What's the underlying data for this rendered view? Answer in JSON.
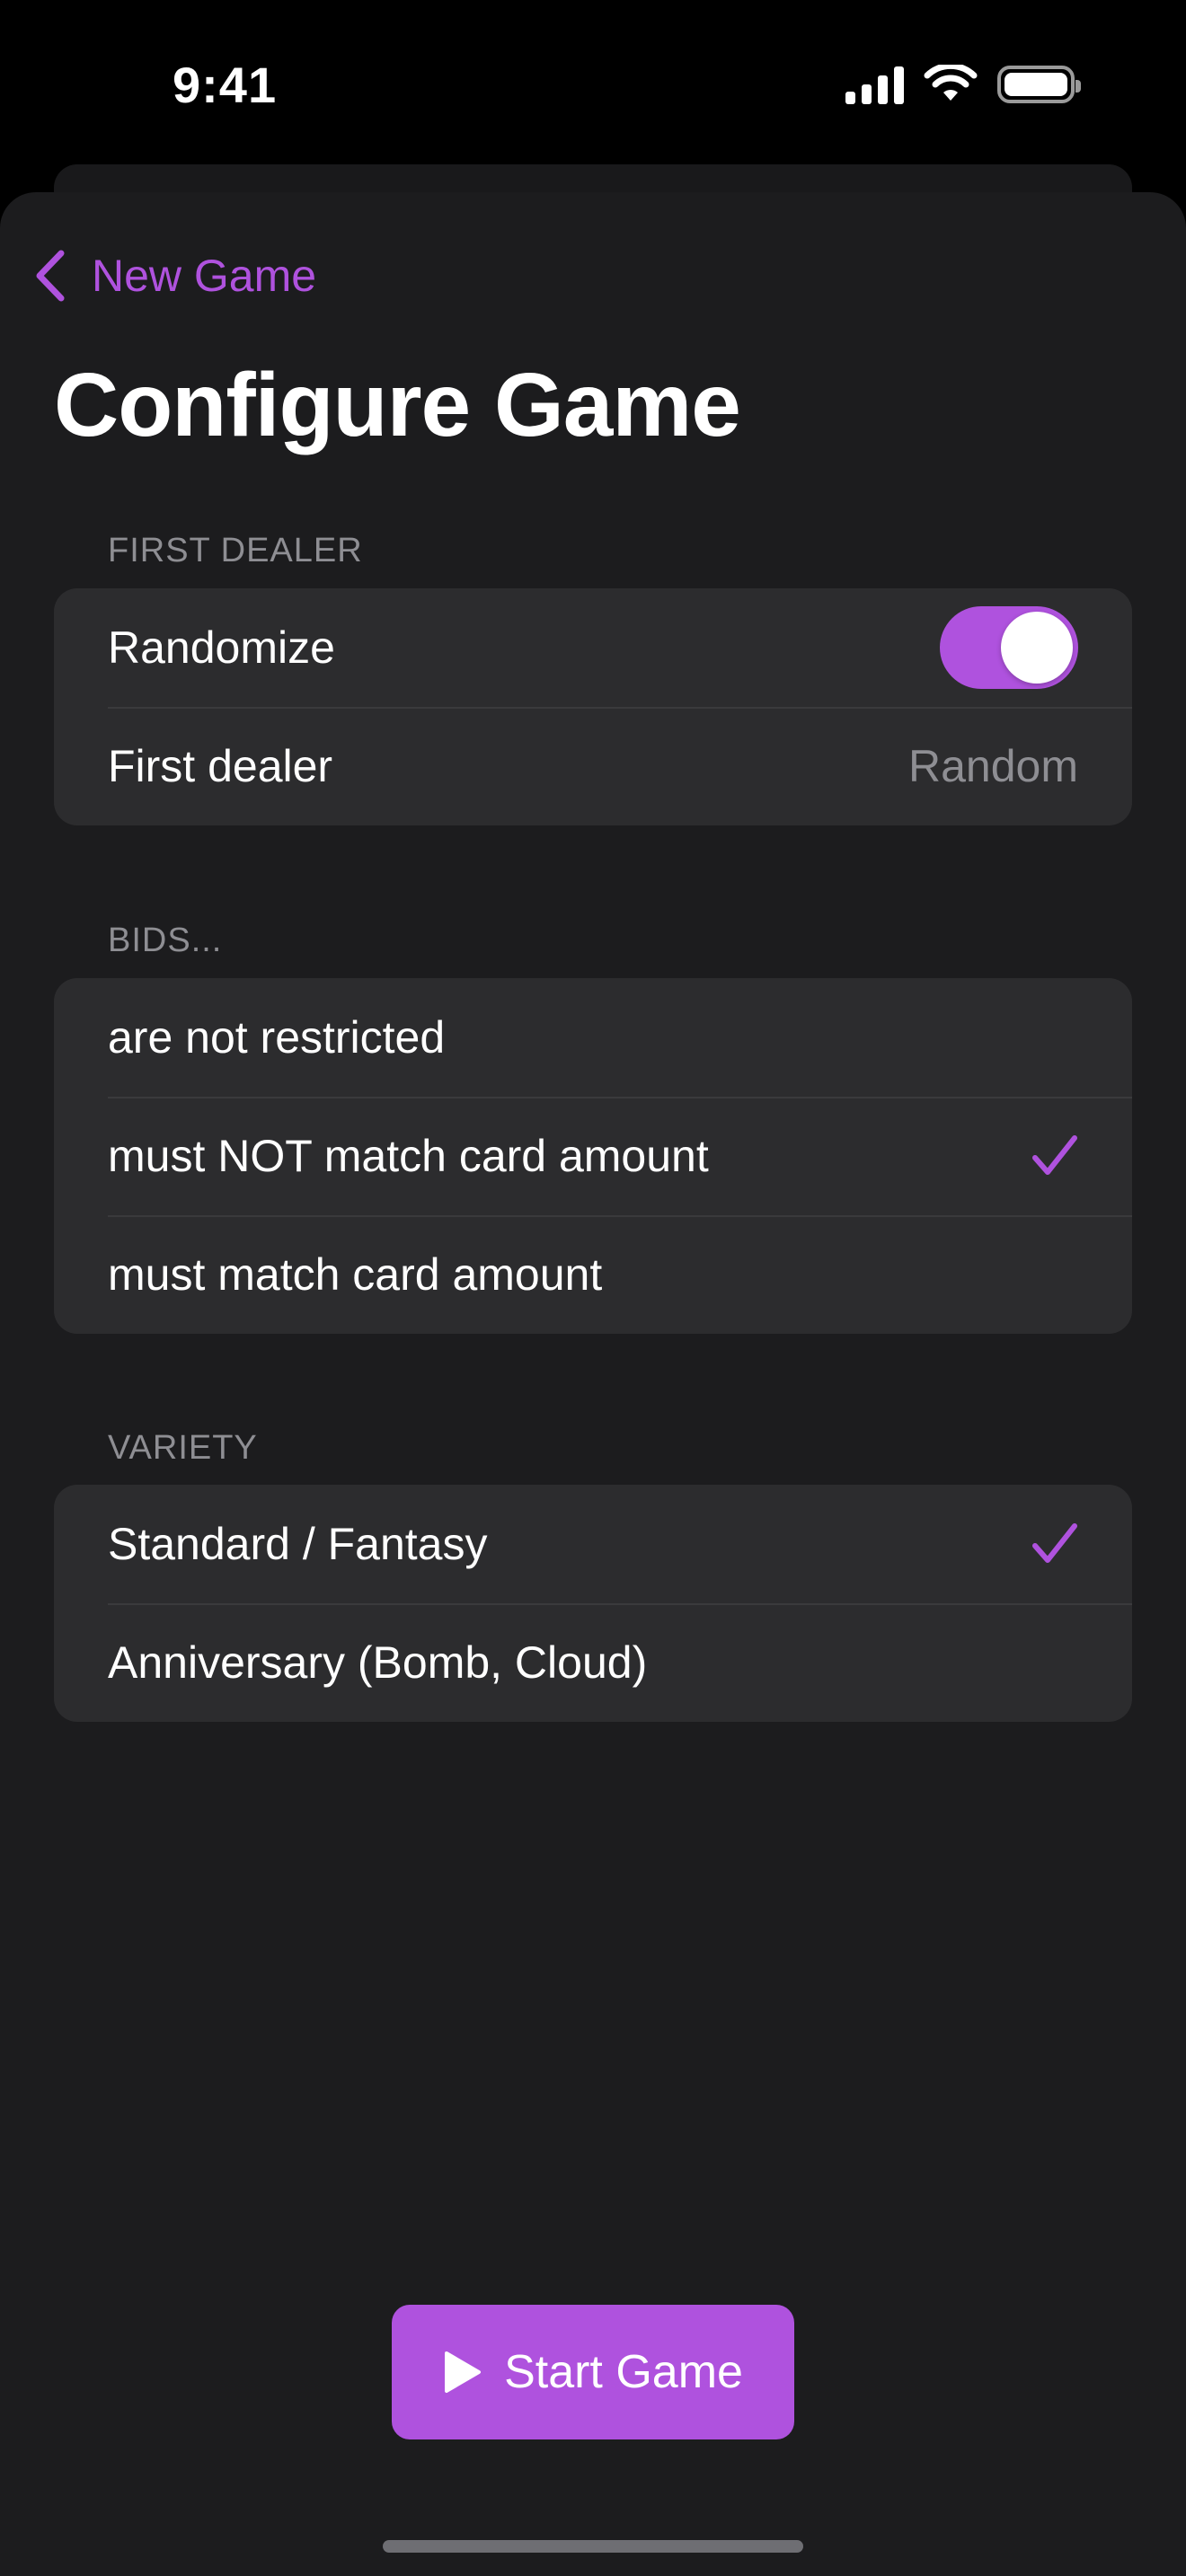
{
  "status_bar": {
    "time": "9:41"
  },
  "nav": {
    "back_label": "New Game"
  },
  "title": "Configure Game",
  "colors": {
    "accent": "#af52de",
    "background": "#1c1c1e",
    "cell": "#2c2c2e",
    "secondary_text": "#8e8e93"
  },
  "sections": {
    "first_dealer": {
      "header": "FIRST DEALER",
      "randomize": {
        "label": "Randomize",
        "on": true
      },
      "first_dealer": {
        "label": "First dealer",
        "value": "Random"
      }
    },
    "bids": {
      "header": "BIDS...",
      "options": [
        {
          "label": "are not restricted",
          "selected": false
        },
        {
          "label": "must NOT match card amount",
          "selected": true
        },
        {
          "label": "must match card amount",
          "selected": false
        }
      ]
    },
    "variety": {
      "header": "VARIETY",
      "options": [
        {
          "label": "Standard / Fantasy",
          "selected": true
        },
        {
          "label": "Anniversary (Bomb, Cloud)",
          "selected": false
        }
      ]
    }
  },
  "start_button": {
    "label": "Start Game"
  },
  "icons": {
    "back": "chevron-left-icon",
    "check": "checkmark-icon",
    "play": "play-icon",
    "signal": "cellular-signal-icon",
    "wifi": "wifi-icon",
    "battery": "battery-icon"
  }
}
